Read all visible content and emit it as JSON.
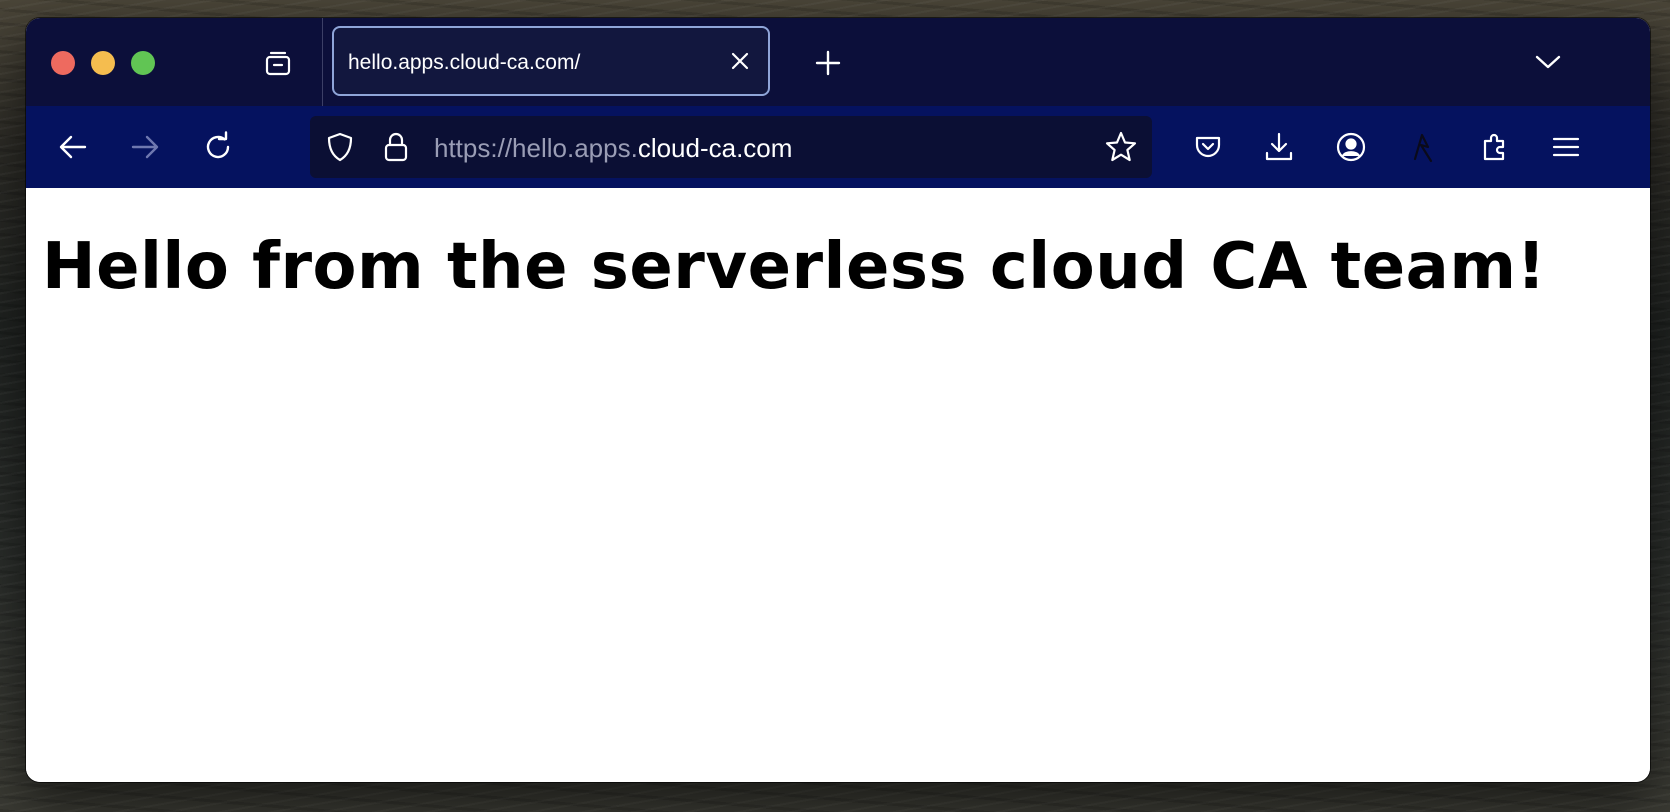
{
  "browser": {
    "tab": {
      "title": "hello.apps.cloud-ca.com/"
    },
    "url": {
      "scheme_prefix": "https://hello.apps.",
      "host": "cloud-ca.com"
    },
    "icons": {
      "tab_list": "tab-list-icon",
      "tab_close": "close-icon",
      "new_tab": "plus-icon",
      "tab_overflow": "chevron-down-icon",
      "back": "back-arrow-icon",
      "forward": "forward-arrow-icon",
      "reload": "reload-icon",
      "tracking_protection": "shield-icon",
      "secure": "lock-icon",
      "bookmark": "star-icon",
      "pocket": "pocket-icon",
      "downloads": "download-icon",
      "account": "account-icon",
      "extension_custom": "extension-icon",
      "extensions": "puzzle-icon",
      "menu": "hamburger-menu-icon"
    },
    "colors": {
      "tabbar_bg": "#0c0f3a",
      "navbar_bg": "#05125f",
      "urlbar_bg": "#0b0f34",
      "tab_border": "#8fa5d8"
    }
  },
  "page": {
    "heading": "Hello from the serverless cloud CA team!"
  }
}
